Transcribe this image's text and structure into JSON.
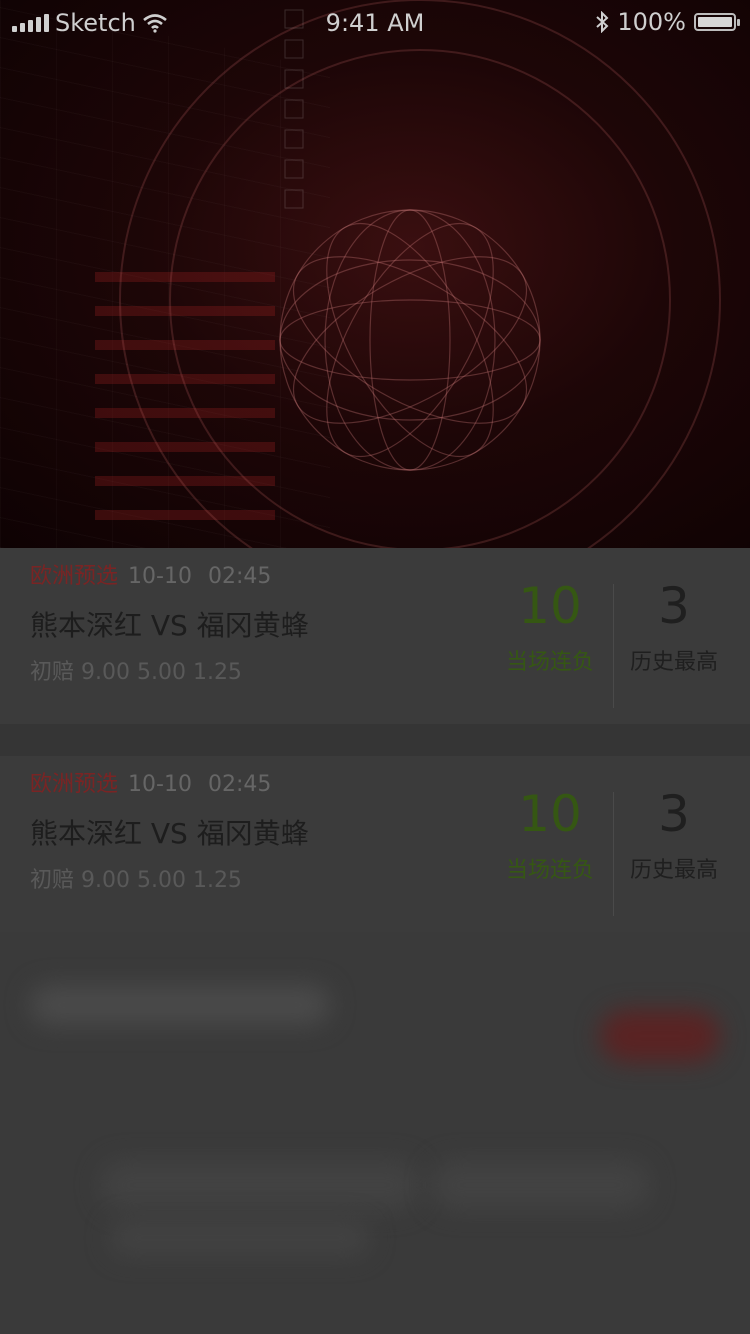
{
  "status_bar": {
    "carrier": "Sketch",
    "time": "9:41 AM",
    "battery_percent": "100%"
  },
  "matches": [
    {
      "league": "欧洲预选",
      "date": "10-10",
      "time": "02:45",
      "teams": "熊本深红 VS 福冈黄蜂",
      "odds": "初赔 9.00 5.00 1.25",
      "stat1": {
        "value": "10",
        "label": "当场连负"
      },
      "stat2": {
        "value": "3",
        "label": "历史最高"
      }
    },
    {
      "league": "欧洲预选",
      "date": "10-10",
      "time": "02:45",
      "teams": "熊本深红 VS 福冈黄蜂",
      "odds": "初赔 9.00 5.00 1.25",
      "stat1": {
        "value": "10",
        "label": "当场连负"
      },
      "stat2": {
        "value": "3",
        "label": "历史最高"
      }
    }
  ],
  "colors": {
    "league": "#7a2424",
    "streak": "#355713",
    "hero_bg": "#1d0607"
  }
}
